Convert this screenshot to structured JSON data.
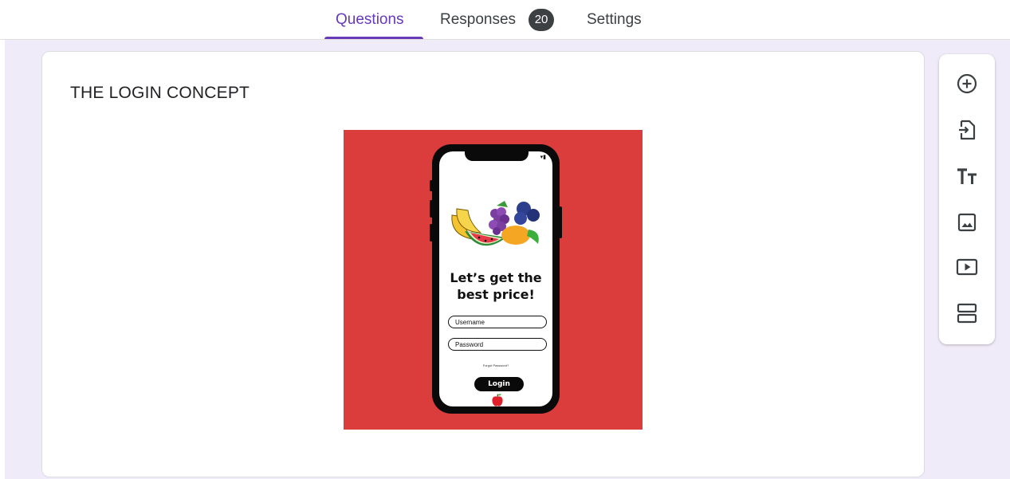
{
  "tabs": {
    "questions": "Questions",
    "responses": "Responses",
    "responses_count": "20",
    "settings": "Settings"
  },
  "form": {
    "title": "THE LOGIN CONCEPT"
  },
  "image": {
    "headline_line1": "Let’s get the",
    "headline_line2": "best price!",
    "username_placeholder": "Username",
    "password_placeholder": "Password",
    "forgot_text": "Forgot Password?",
    "login_label": "Login",
    "background_color": "#db3d3d"
  },
  "toolbar": {
    "items": [
      {
        "name": "add-question",
        "icon": "add-circle-icon"
      },
      {
        "name": "import-questions",
        "icon": "import-icon"
      },
      {
        "name": "add-title-description",
        "icon": "title-icon"
      },
      {
        "name": "add-image",
        "icon": "image-icon"
      },
      {
        "name": "add-video",
        "icon": "video-icon"
      },
      {
        "name": "add-section",
        "icon": "section-icon"
      }
    ]
  },
  "colors": {
    "accent": "#673ab7",
    "canvas": "#f0ebf8"
  }
}
